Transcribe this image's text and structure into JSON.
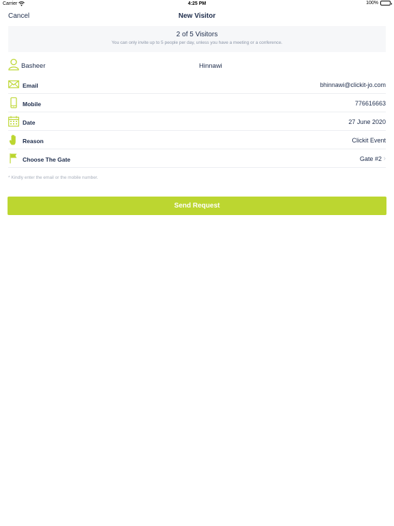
{
  "status_bar": {
    "carrier": "Carrier",
    "time": "4:25 PM",
    "battery": "100%"
  },
  "nav": {
    "cancel": "Cancel",
    "title": "New Visitor"
  },
  "info": {
    "count": "2 of 5 Visitors",
    "note": "You can only invite up to 5 people per day, unless you have a meeting or a conference."
  },
  "name": {
    "first": "Basheer",
    "last": "Hinnawi"
  },
  "rows": [
    {
      "label": "Email",
      "value": "bhinnawi@clickit-jo.com",
      "icon": "envelope-icon"
    },
    {
      "label": "Mobile",
      "value": "776616663",
      "icon": "phone-icon"
    },
    {
      "label": "Date",
      "value": "27 June 2020",
      "icon": "calendar-icon"
    },
    {
      "label": "Reason",
      "value": "Clickit Event",
      "icon": "hand-icon"
    },
    {
      "label": "Choose The Gate",
      "value": "Gate #2",
      "icon": "flag-icon"
    }
  ],
  "hint": "* Kindly enter the email or the mobile number.",
  "send_button": "Send Request",
  "colors": {
    "accent": "#bcd630",
    "text": "#1c2b4a",
    "muted": "#8a94a6"
  }
}
